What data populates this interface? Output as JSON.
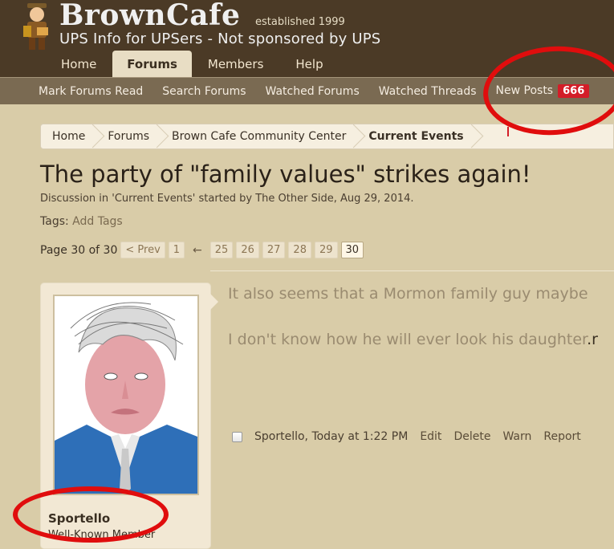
{
  "header": {
    "site_name": "BrownCafe",
    "established": "established 1999",
    "tagline": "UPS Info for UPSers - Not sponsored by UPS"
  },
  "tabs": [
    {
      "label": "Home"
    },
    {
      "label": "Forums",
      "active": true
    },
    {
      "label": "Members"
    },
    {
      "label": "Help"
    }
  ],
  "subnav": {
    "items": [
      "Mark Forums Read",
      "Search Forums",
      "Watched Forums",
      "Watched Threads"
    ],
    "new_posts_label": "New Posts",
    "new_posts_count": "666"
  },
  "breadcrumb": [
    "Home",
    "Forums",
    "Brown Cafe Community Center",
    "Current Events"
  ],
  "thread": {
    "title": "The party of \"family values\" strikes again!",
    "meta": "Discussion in 'Current Events' started by The Other Side, Aug 29, 2014.",
    "tags_label": "Tags:",
    "tags_add": "Add Tags"
  },
  "pager": {
    "label": "Page 30 of 30",
    "prev": "< Prev",
    "first": "1",
    "ellipsis": "←",
    "pages": [
      "25",
      "26",
      "27",
      "28",
      "29",
      "30"
    ],
    "current": "30"
  },
  "post": {
    "username": "Sportello",
    "user_title": "Well-Known Member",
    "line1": "It also seems that a Mormon family guy maybe",
    "line2": "I don't know how he will ever look his daughter",
    "line2_end": ".r",
    "author_time": "Sportello, Today at 1:22 PM",
    "actions": [
      "Edit",
      "Delete",
      "Warn",
      "Report"
    ]
  },
  "colors": {
    "header_bg": "#4b3a26",
    "page_bg": "#d9cca8",
    "badge": "#d31d28",
    "annotation": "#e00d0d"
  }
}
